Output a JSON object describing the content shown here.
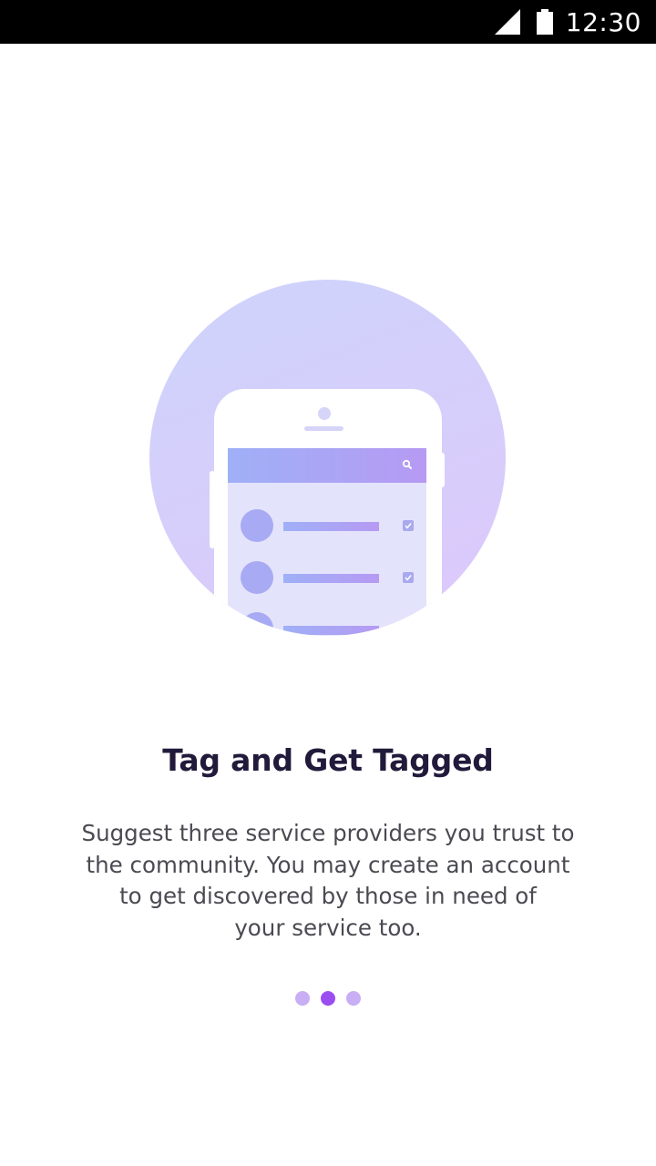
{
  "status_bar": {
    "time": "12:30",
    "icons": [
      "cell-signal-icon",
      "battery-icon"
    ]
  },
  "illustration": {
    "icon": "phone-list-illustration",
    "search_icon": "search-icon",
    "checkbox_icon": "checkbox-checked-icon",
    "colors": {
      "circle_top": "#cfd3fb",
      "circle_bottom": "#dcc9fb",
      "bar_start": "#9fb0f7",
      "bar_end": "#b69af3"
    }
  },
  "onboarding": {
    "title": "Tag and Get Tagged",
    "description_lines": [
      "Suggest three service providers you trust to",
      "the community. You may create an account",
      "to get discovered by those in need of",
      "your service too."
    ]
  },
  "pager": {
    "page_count": 3,
    "active_index": 1,
    "colors": {
      "active": "#9a4ef0",
      "inactive": "#c8aef4"
    }
  }
}
